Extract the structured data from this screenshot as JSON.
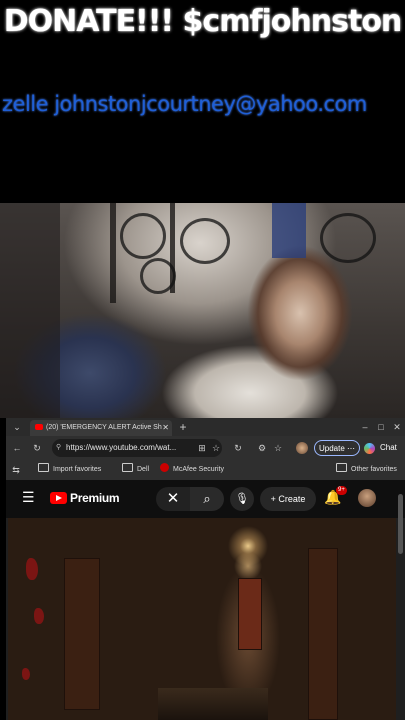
{
  "overlay": {
    "donate_text": "DONATE!!! $cmfjohnston",
    "zelle_text": "zelle johnstonjcourtney@yahoo.com"
  },
  "browser": {
    "tab": {
      "title": "(20) 'EMERGENCY ALERT Active Sh",
      "favicon": "youtube-icon"
    },
    "new_tab_symbol": "+",
    "address": {
      "url": "https://www.youtube.com/wat...",
      "update_label": "Update",
      "chat_label": "Chat"
    },
    "favorites": {
      "items": [
        "Import favorites",
        "Dell",
        "McAfee Security"
      ],
      "other": "Other favorites"
    }
  },
  "youtube": {
    "brand": "Premium",
    "create_label": "Create",
    "notification_count": "9+"
  },
  "colors": {
    "donate_text": "#ffffff",
    "zelle_text": "#1f5fd6",
    "youtube_red": "#ff0000",
    "browser_bg": "#1f1f1f"
  }
}
